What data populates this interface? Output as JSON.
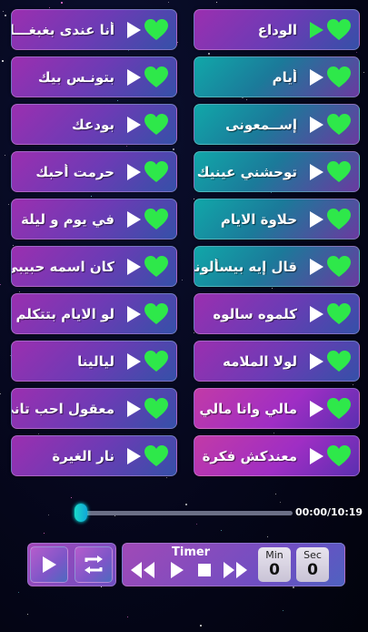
{
  "songs": [
    {
      "title": "أنا عندى بغبغـــان",
      "theme": "purple",
      "active": false
    },
    {
      "title": "الوداع",
      "theme": "purple",
      "active": true
    },
    {
      "title": "بتونـس بيك",
      "theme": "purple",
      "active": false
    },
    {
      "title": "أيام",
      "theme": "teal",
      "active": false
    },
    {
      "title": "بودعك",
      "theme": "purple",
      "active": false
    },
    {
      "title": "إســمعونى",
      "theme": "teal",
      "active": false
    },
    {
      "title": "حرمت أحبك",
      "theme": "purple",
      "active": false
    },
    {
      "title": "توحشني عينيك",
      "theme": "teal",
      "active": false
    },
    {
      "title": "في يوم و ليلة",
      "theme": "purple",
      "active": false
    },
    {
      "title": "حلاوة الايام",
      "theme": "teal",
      "active": false
    },
    {
      "title": "كان اسمه حبيبي",
      "theme": "purple",
      "active": false
    },
    {
      "title": "قال إيه بيسألوني",
      "theme": "teal",
      "active": false
    },
    {
      "title": "لو الايام بتتكلم",
      "theme": "purple",
      "active": false
    },
    {
      "title": "كلموه سالوه",
      "theme": "purple",
      "active": false
    },
    {
      "title": "ليالينا",
      "theme": "purple",
      "active": false
    },
    {
      "title": "لولا الملامه",
      "theme": "purple",
      "active": false
    },
    {
      "title": "معقول احب تاني",
      "theme": "purple",
      "active": false
    },
    {
      "title": "مالي وانا مالي",
      "theme": "magenta",
      "active": false
    },
    {
      "title": "نار الغيرة",
      "theme": "purple",
      "active": false
    },
    {
      "title": "معندكش فكرة",
      "theme": "magenta",
      "active": false
    }
  ],
  "player": {
    "time": "00:00/10:19",
    "progress": 0.0
  },
  "timer": {
    "label": "Timer",
    "min_label": "Min",
    "min_value": "0",
    "sec_label": "Sec",
    "sec_value": "0"
  },
  "colors": {
    "heart": "#2ee84a",
    "play": "#ffffff",
    "active_play": "#2ee84a"
  }
}
